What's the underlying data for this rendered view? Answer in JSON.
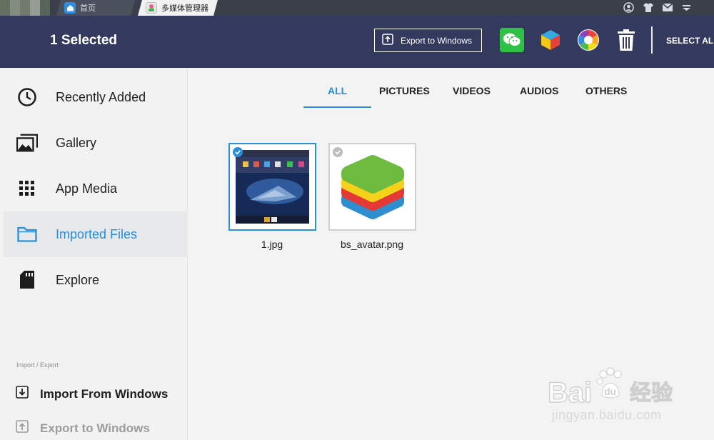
{
  "titlebar": {
    "tabs": [
      {
        "label": "首页",
        "icon": "home-icon"
      },
      {
        "label": "多媒体管理器",
        "icon": "media-manager-icon"
      }
    ],
    "right_icons": [
      "account-icon",
      "shirt-icon",
      "mail-icon",
      "dropdown-icon"
    ]
  },
  "header": {
    "title": "1 Selected",
    "export_label": "Export to Windows",
    "share_apps": [
      "wechat-icon",
      "cube-app-icon",
      "color-wheel-icon"
    ],
    "delete_icon": "trash-icon",
    "select_all_label": "SELECT ALL",
    "background": "#333a5e"
  },
  "sidebar": {
    "items": [
      {
        "label": "Recently Added",
        "icon": "clock-icon",
        "active": false
      },
      {
        "label": "Gallery",
        "icon": "gallery-icon",
        "active": false
      },
      {
        "label": "App Media",
        "icon": "grid-icon",
        "active": false
      },
      {
        "label": "Imported Files",
        "icon": "folder-icon",
        "active": true
      },
      {
        "label": "Explore",
        "icon": "sd-card-icon",
        "active": false
      }
    ],
    "import_export_heading": "Import / Export",
    "import_label": "Import From Windows",
    "export_label": "Export to Windows"
  },
  "main": {
    "tabs": [
      {
        "label": "ALL",
        "active": true
      },
      {
        "label": "PICTURES",
        "active": false
      },
      {
        "label": "VIDEOS",
        "active": false
      },
      {
        "label": "AUDIOS",
        "active": false
      },
      {
        "label": "OTHERS",
        "active": false
      }
    ],
    "files": [
      {
        "name": "1.jpg",
        "selected": true
      },
      {
        "name": "bs_avatar.png",
        "selected": false
      }
    ]
  },
  "watermark": {
    "brand": "Bai",
    "brand_suffix": "du",
    "cn": "经验",
    "url": "jingyan.baidu.com"
  },
  "colors": {
    "accent": "#2a8fd8",
    "header": "#333a5e"
  }
}
